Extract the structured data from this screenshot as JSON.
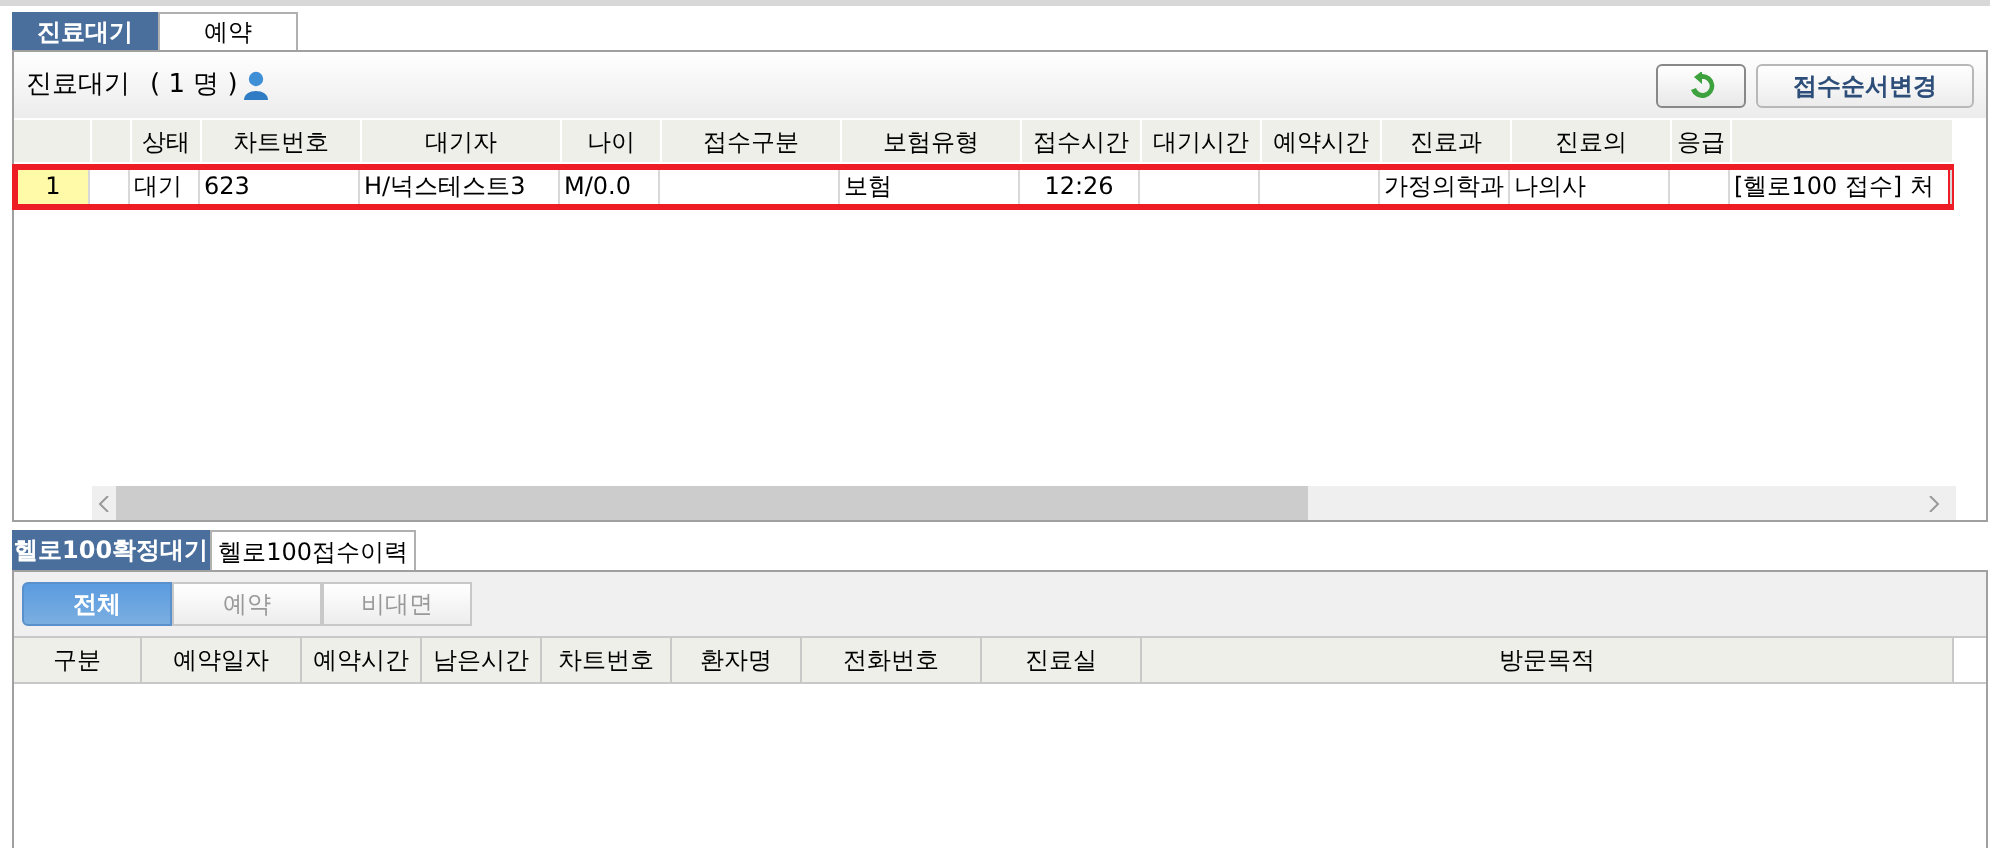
{
  "top_tabs": [
    {
      "label": "진료대기",
      "selected": true
    },
    {
      "label": "예약",
      "selected": false
    }
  ],
  "waiting": {
    "title": "진료대기",
    "count": "( 1 명 )",
    "reorder_button": "접수순서변경"
  },
  "waiting_table": {
    "columns": [
      "",
      "",
      "상태",
      "차트번호",
      "대기자",
      "나이",
      "접수구분",
      "보험유형",
      "접수시간",
      "대기시간",
      "예약시간",
      "진료과",
      "진료의",
      "응급",
      ""
    ],
    "rows": [
      {
        "selected": true,
        "cells": [
          "1",
          "",
          "대기",
          "623",
          "H/넉스테스트3",
          "M/0.0",
          "",
          "보험",
          "12:26",
          "",
          "",
          "가정의학과",
          "나의사",
          "",
          "[헬로100 접수] 처"
        ]
      }
    ]
  },
  "bottom_tabs": [
    {
      "label": "헬로100확정대기",
      "selected": true
    },
    {
      "label": "헬로100접수이력",
      "selected": false
    }
  ],
  "filters": [
    {
      "label": "전체",
      "selected": true
    },
    {
      "label": "예약",
      "selected": false
    },
    {
      "label": "비대면",
      "selected": false
    }
  ],
  "hello_table": {
    "columns": [
      "구분",
      "예약일자",
      "예약시간",
      "남은시간",
      "차트번호",
      "환자명",
      "전화번호",
      "진료실",
      "방문목적"
    ]
  }
}
